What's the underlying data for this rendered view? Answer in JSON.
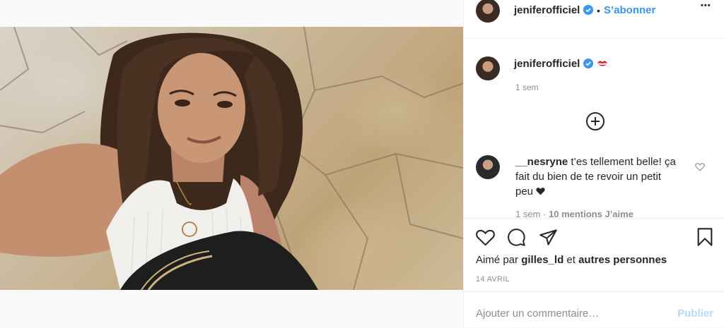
{
  "post": {
    "username": "jeniferofficiel",
    "follow_separator": "•",
    "follow_label": "S’abonner",
    "more_label": "•••",
    "caption_emoji": "kiss-mark-icon",
    "time_ago": "1 sem"
  },
  "comments": [
    {
      "username": "__nesryne",
      "text": "t’es tellement belle! ça fait du bien de te revoir un petit peu",
      "emoji": "black-heart",
      "time": "1 sem",
      "mentions": "10 mentions J’aime",
      "meta_separator": "·"
    }
  ],
  "likes": {
    "prefix": "Aimé par",
    "user": "gilles_ld",
    "connector": "et",
    "others": "autres personnes"
  },
  "date": "14 AVRIL",
  "composer": {
    "placeholder": "Ajouter un commentaire…",
    "publish_label": "Publier"
  },
  "colors": {
    "link_blue": "#3897f0",
    "verified_blue": "#3897f0",
    "publish_disabled": "#b3dbff",
    "secondary_text": "#8e8e8e"
  }
}
